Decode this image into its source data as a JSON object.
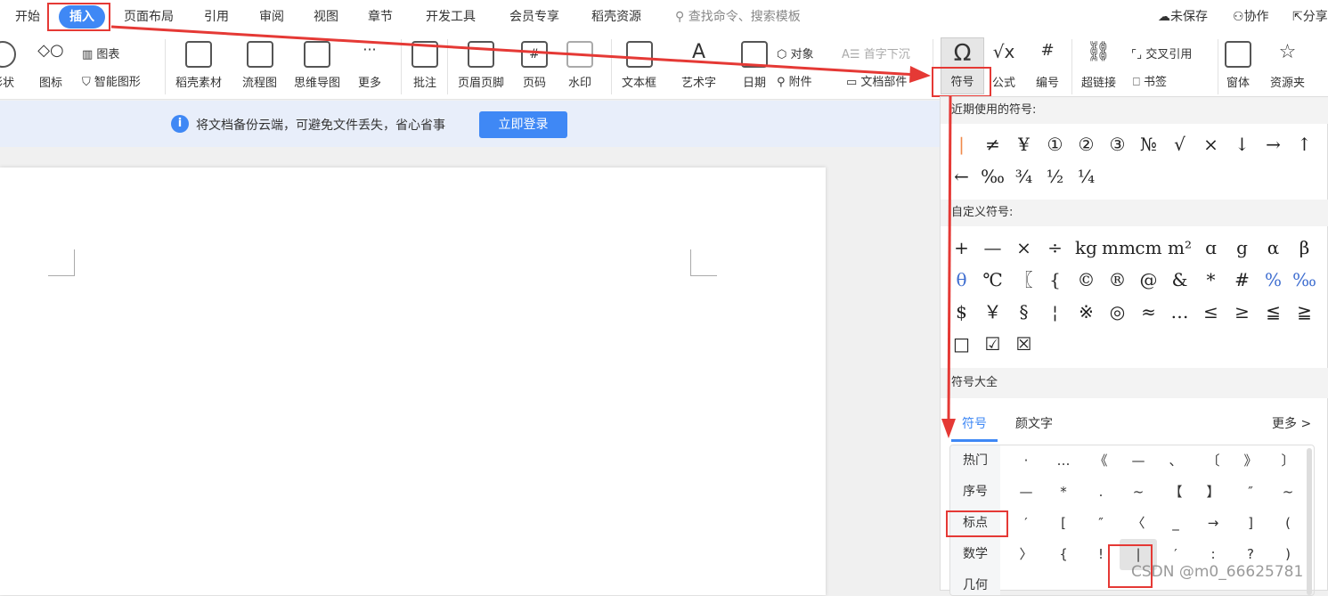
{
  "menu": {
    "tabs": [
      "开始",
      "插入",
      "页面布局",
      "引用",
      "审阅",
      "视图",
      "章节",
      "开发工具",
      "会员专享",
      "稻壳资源"
    ],
    "active": "插入",
    "search_placeholder": "查找命令、搜索模板",
    "unsaved": "未保存",
    "collab": "协作",
    "share": "分享"
  },
  "ribbon": {
    "shape": "形状",
    "icon": "图标",
    "chart": "图表",
    "smart_art": "智能图形",
    "docer_material": "稻壳素材",
    "flowchart": "流程图",
    "mindmap": "思维导图",
    "more": "更多",
    "comment": "批注",
    "header_footer": "页眉页脚",
    "page_num": "页码",
    "watermark": "水印",
    "textbox": "文本框",
    "wordart": "艺术字",
    "date": "日期",
    "object": "对象",
    "dropcap": "首字下沉",
    "attachment": "附件",
    "doc_parts": "文档部件",
    "symbol": "符号",
    "formula": "公式",
    "numbering": "编号",
    "hyperlink": "超链接",
    "cross_ref": "交叉引用",
    "bookmark": "书签",
    "window": "窗体",
    "resource": "资源夹"
  },
  "notice": {
    "text": "将文档备份云端，可避免文件丢失，省心省事",
    "login": "立即登录"
  },
  "panel": {
    "recent_title": "近期使用的符号:",
    "recent": [
      "|",
      "≠",
      "¥",
      "①",
      "②",
      "③",
      "№",
      "√",
      "×",
      "↓",
      "→",
      "↑",
      "←",
      "‰",
      "¾",
      "½",
      "¼"
    ],
    "custom_title": "自定义符号:",
    "custom": [
      "+",
      "—",
      "×",
      "÷",
      "kg",
      "mm",
      "cm",
      "m²",
      "ɑ",
      "g",
      "α",
      "β",
      "θ",
      "℃",
      "〖",
      "{",
      "©",
      "®",
      "@",
      "&",
      "*",
      "#",
      "%",
      "‰",
      "$",
      "￥",
      "§",
      "¦",
      "※",
      "◎",
      "≈",
      "…",
      "≤",
      "≥",
      "≦",
      "≧",
      "□",
      "☑",
      "☒"
    ],
    "all_title": "符号大全",
    "tabs": [
      "符号",
      "颜文字"
    ],
    "more": "更多 >",
    "categories": [
      "热门",
      "序号",
      "标点",
      "数学",
      "几何"
    ],
    "selected_category": "标点",
    "punct": [
      "·",
      "…",
      "《",
      "—",
      "、",
      "〔",
      "》",
      "〕",
      "—",
      "*",
      ".",
      "~",
      "【",
      "】",
      "″",
      "~",
      "′",
      "[",
      "″",
      "〈",
      "_",
      "→",
      "]",
      "(",
      "〉",
      "{",
      "!",
      "|",
      "′",
      ":",
      "?",
      ")"
    ],
    "selected_symbol": "|"
  },
  "watermark": "CSDN @m0_66625781",
  "colors": {
    "accent": "#3f88f5",
    "annotation": "#e53935"
  }
}
